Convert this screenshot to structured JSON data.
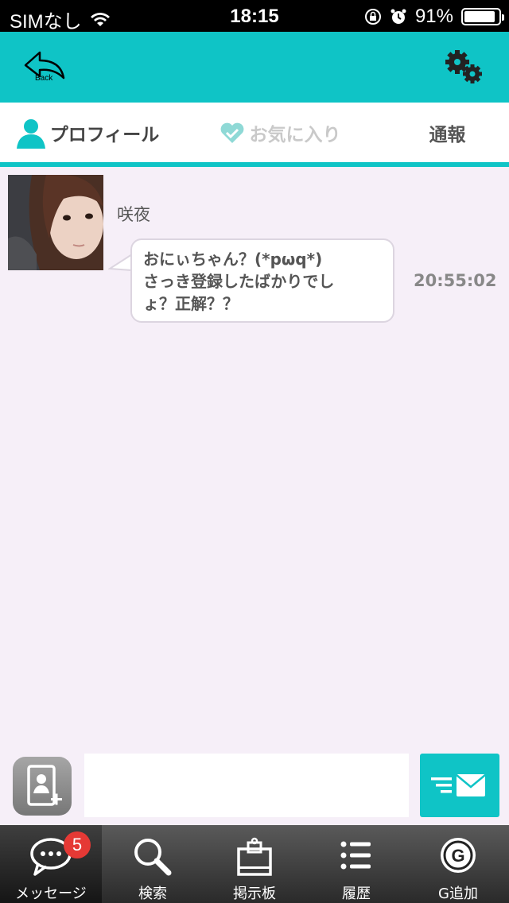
{
  "status_bar": {
    "carrier": "SIMなし",
    "time": "18:15",
    "battery_percent": "91%",
    "battery_level": 0.91
  },
  "header": {
    "back_label": "Back"
  },
  "tabs": {
    "profile": "プロフィール",
    "favorite": "お気に入り",
    "report": "通報"
  },
  "message": {
    "sender": "咲夜",
    "lines": [
      "おにぃちゃん？(*pωq*)",
      "さっき登録したばかりでし",
      "ょ？正解？？"
    ],
    "time": "20:55:02"
  },
  "composer": {
    "value": ""
  },
  "bottom_nav": {
    "messages": "メッセージ",
    "messages_badge": "5",
    "search": "検索",
    "board": "掲示板",
    "history": "履歴",
    "g_add": "G追加"
  },
  "colors": {
    "accent": "#0fc4c6",
    "background": "#f6eff8",
    "badge": "#e53935"
  }
}
